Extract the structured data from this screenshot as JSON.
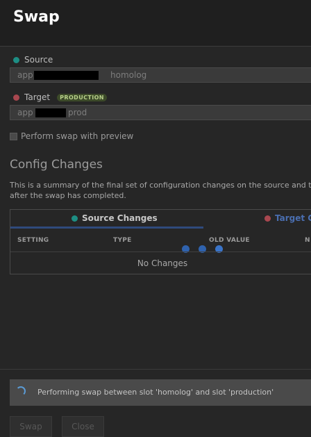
{
  "header": {
    "title": "Swap"
  },
  "source": {
    "label": "Source",
    "dot_color": "#1d8e84",
    "value_prefix": "app",
    "value_suffix": "homolog"
  },
  "target": {
    "label": "Target",
    "dot_color": "#a8474f",
    "badge": "PRODUCTION",
    "value_prefix": "app",
    "value_suffix": "prod"
  },
  "preview_checkbox": {
    "label": "Perform swap with preview",
    "checked": false
  },
  "config": {
    "title": "Config Changes",
    "description_line1": "This is a summary of the final set of configuration changes on the source and targe",
    "description_line2": "after the swap has completed.",
    "tabs": [
      {
        "label": "Source Changes",
        "icon": "teal-dot-icon",
        "color": "#1d8e84",
        "active": true
      },
      {
        "label": "Target Ch",
        "icon": "red-dot-icon",
        "color": "#a8474f",
        "active": false
      }
    ],
    "columns": [
      "SETTING",
      "TYPE",
      "OLD VALUE",
      "N"
    ],
    "empty_text": "No Changes"
  },
  "status": {
    "text": "Performing swap between slot 'homolog' and slot 'production'"
  },
  "buttons": {
    "swap": "Swap",
    "close": "Close"
  }
}
